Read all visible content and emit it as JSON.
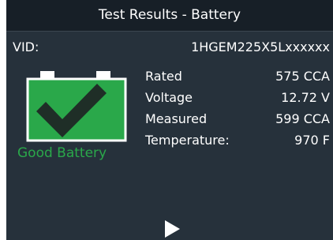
{
  "header": {
    "title": "Test Results - Battery"
  },
  "vehicle": {
    "vid_label": "VID:",
    "vid_value": "1HGEM225X5Lxxxxxx"
  },
  "result": {
    "status": "Good Battery",
    "status_color": "#2aa84a",
    "icon": "battery-check-icon"
  },
  "metrics": [
    {
      "label": "Rated",
      "value": "575 CCA"
    },
    {
      "label": "Voltage",
      "value": "12.72 V"
    },
    {
      "label": "Measured",
      "value": "599 CCA"
    },
    {
      "label": "Temperature:",
      "value": "970 F"
    }
  ],
  "controls": {
    "next_icon": "play-icon"
  }
}
